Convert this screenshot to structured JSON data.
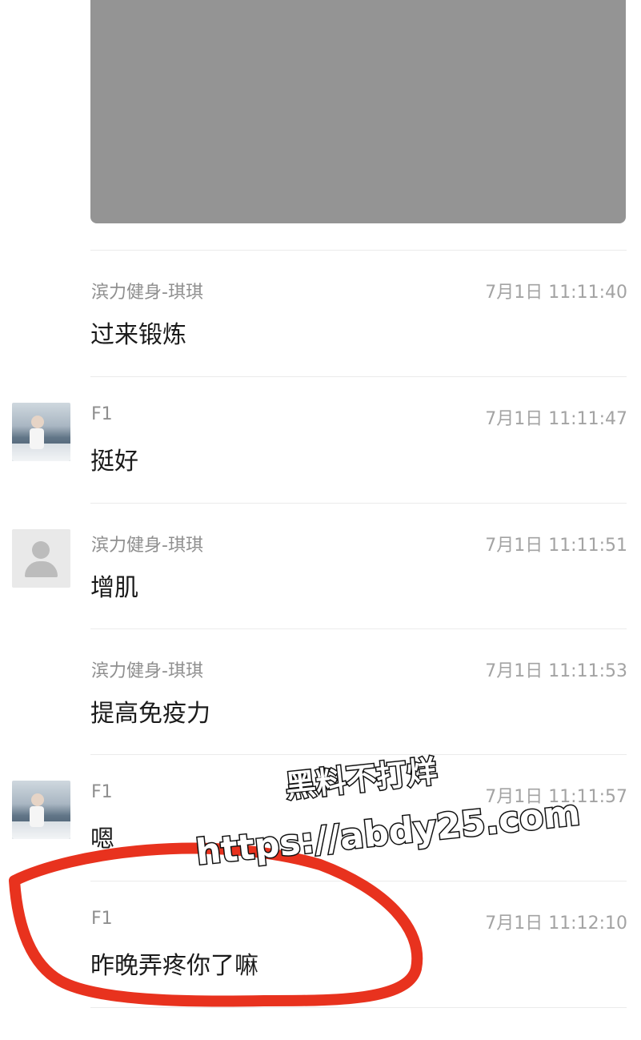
{
  "messages": [
    {
      "sender": "滨力健身-琪琪",
      "time": "7月1日 11:11:40",
      "text": "过来锻炼",
      "avatar": "none"
    },
    {
      "sender": "F1",
      "time": "7月1日 11:11:47",
      "text": "挺好",
      "avatar": "photo-boat"
    },
    {
      "sender": "滨力健身-琪琪",
      "time": "7月1日 11:11:51",
      "text": "增肌",
      "avatar": "default-person-icon"
    },
    {
      "sender": "滨力健身-琪琪",
      "time": "7月1日 11:11:53",
      "text": "提高免疫力",
      "avatar": "none"
    },
    {
      "sender": "F1",
      "time": "7月1日 11:11:57",
      "text": "嗯",
      "avatar": "photo-boat"
    },
    {
      "sender": "F1",
      "time": "7月1日 11:12:10",
      "text": "昨晚弄疼你了嘛",
      "avatar": "none"
    }
  ],
  "watermark": {
    "line1": "黑料不打烊",
    "line2": "https://abdy25.com"
  },
  "colors": {
    "annotation_circle": "#e8321e",
    "image_placeholder": "#949494"
  }
}
